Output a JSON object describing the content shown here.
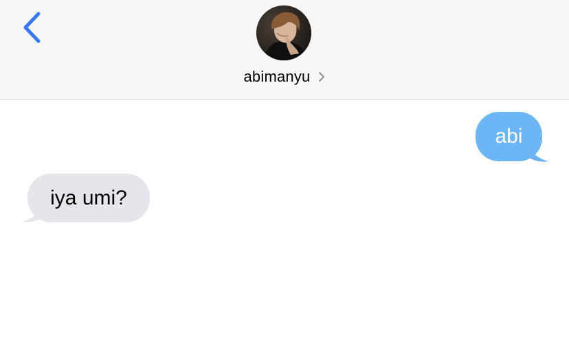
{
  "header": {
    "back_icon": "chevron-left-icon",
    "contact_name": "abimanyu",
    "contact_chevron_icon": "chevron-right-icon",
    "avatar": "contact-photo"
  },
  "messages": [
    {
      "direction": "outgoing",
      "text": "abi"
    },
    {
      "direction": "incoming",
      "text": "iya umi?"
    }
  ],
  "colors": {
    "accent": "#3478f6",
    "outgoing_bubble": "#6cb6f6",
    "incoming_bubble": "#e6e5eb",
    "header_background": "#f7f7f7"
  }
}
